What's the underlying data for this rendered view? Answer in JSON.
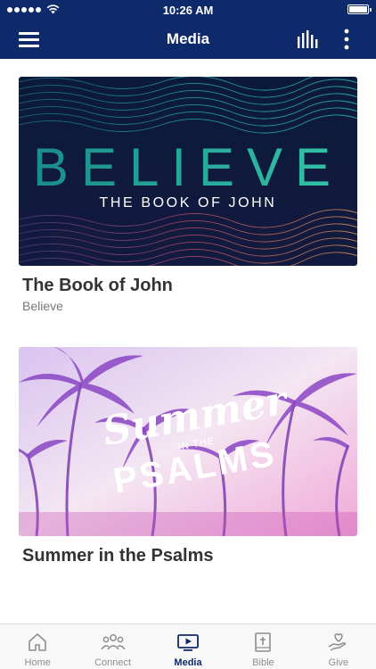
{
  "status_bar": {
    "time": "10:26 AM"
  },
  "nav": {
    "title": "Media"
  },
  "cards": [
    {
      "title": "The Book of John",
      "subtitle": "Believe",
      "art_title": "BELIEVE",
      "art_subtitle": "THE BOOK OF JOHN"
    },
    {
      "title": "Summer in the Psalms",
      "art_line1": "Summer",
      "art_line2": "IN THE",
      "art_line3": "PSALMS"
    }
  ],
  "tabs": [
    {
      "label": "Home",
      "icon": "home-icon"
    },
    {
      "label": "Connect",
      "icon": "people-icon"
    },
    {
      "label": "Media",
      "icon": "media-play-icon",
      "active": true
    },
    {
      "label": "Bible",
      "icon": "bible-icon"
    },
    {
      "label": "Give",
      "icon": "give-hand-icon"
    }
  ],
  "colors": {
    "primary": "#0f2a6a",
    "inactive_tab": "#8e8e8e"
  }
}
